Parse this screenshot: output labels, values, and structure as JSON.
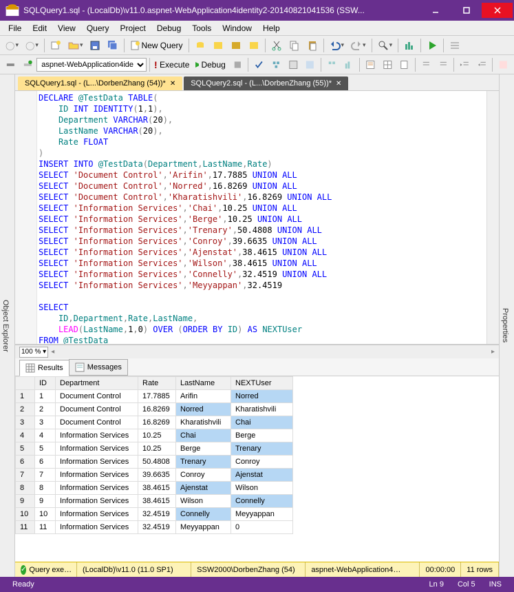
{
  "window": {
    "title": "SQLQuery1.sql - (LocalDb)\\v11.0.aspnet-WebApplication4identity2-20140821041536 (SSW..."
  },
  "menu": [
    "File",
    "Edit",
    "View",
    "Query",
    "Project",
    "Debug",
    "Tools",
    "Window",
    "Help"
  ],
  "toolbar1": {
    "new_query": "New Query"
  },
  "toolbar2": {
    "db_combo": "aspnet-WebApplication4ide",
    "execute": "Execute",
    "debug": "Debug"
  },
  "side_tabs": {
    "left": "Object Explorer",
    "right": "Properties"
  },
  "editor_tabs": [
    {
      "label": "SQLQuery1.sql - (L...\\DorbenZhang (54))*",
      "active": true
    },
    {
      "label": "SQLQuery2.sql - (L...\\DorbenZhang (55))*",
      "active": false
    }
  ],
  "code_lines": [
    "DECLARE @TestData TABLE(",
    "    ID INT IDENTITY(1,1),",
    "    Department VARCHAR(20),",
    "    LastName VARCHAR(20),",
    "    Rate FLOAT",
    ")",
    "INSERT INTO @TestData(Department,LastName,Rate)",
    "SELECT 'Document Control','Arifin',17.7885 UNION ALL",
    "SELECT 'Document Control','Norred',16.8269 UNION ALL",
    "SELECT 'Document Control','Kharatishvili',16.8269 UNION ALL",
    "SELECT 'Information Services','Chai',10.25 UNION ALL",
    "SELECT 'Information Services','Berge',10.25 UNION ALL",
    "SELECT 'Information Services','Trenary',50.4808 UNION ALL",
    "SELECT 'Information Services','Conroy',39.6635 UNION ALL",
    "SELECT 'Information Services','Ajenstat',38.4615 UNION ALL",
    "SELECT 'Information Services','Wilson',38.4615 UNION ALL",
    "SELECT 'Information Services','Connelly',32.4519 UNION ALL",
    "SELECT 'Information Services','Meyyappan',32.4519",
    "",
    "SELECT",
    "    ID,Department,Rate,LastName,",
    "    LEAD(LastName,1,0) OVER (ORDER BY ID) AS NEXTUser",
    "FROM @TestData"
  ],
  "zoom": "100 %",
  "result_tabs": {
    "results": "Results",
    "messages": "Messages"
  },
  "grid": {
    "columns": [
      "",
      "ID",
      "Department",
      "Rate",
      "LastName",
      "NEXTUser"
    ],
    "rows": [
      [
        "1",
        "1",
        "Document Control",
        "17.7885",
        "Arifin",
        "Norred"
      ],
      [
        "2",
        "2",
        "Document Control",
        "16.8269",
        "Norred",
        "Kharatishvili"
      ],
      [
        "3",
        "3",
        "Document Control",
        "16.8269",
        "Kharatishvili",
        "Chai"
      ],
      [
        "4",
        "4",
        "Information Services",
        "10.25",
        "Chai",
        "Berge"
      ],
      [
        "5",
        "5",
        "Information Services",
        "10.25",
        "Berge",
        "Trenary"
      ],
      [
        "6",
        "6",
        "Information Services",
        "50.4808",
        "Trenary",
        "Conroy"
      ],
      [
        "7",
        "7",
        "Information Services",
        "39.6635",
        "Conroy",
        "Ajenstat"
      ],
      [
        "8",
        "8",
        "Information Services",
        "38.4615",
        "Ajenstat",
        "Wilson"
      ],
      [
        "9",
        "9",
        "Information Services",
        "38.4615",
        "Wilson",
        "Connelly"
      ],
      [
        "10",
        "10",
        "Information Services",
        "32.4519",
        "Connelly",
        "Meyyappan"
      ],
      [
        "11",
        "11",
        "Information Services",
        "32.4519",
        "Meyyappan",
        "0"
      ]
    ]
  },
  "status_yellow": {
    "exec": "Query exe…",
    "server": "(LocalDb)\\v11.0 (11.0 SP1)",
    "user": "SSW2000\\DorbenZhang (54)",
    "db": "aspnet-WebApplication4…",
    "time": "00:00:00",
    "rows": "11 rows"
  },
  "statusbar": {
    "ready": "Ready",
    "ln": "Ln 9",
    "col": "Col 5",
    "ins": "INS"
  }
}
